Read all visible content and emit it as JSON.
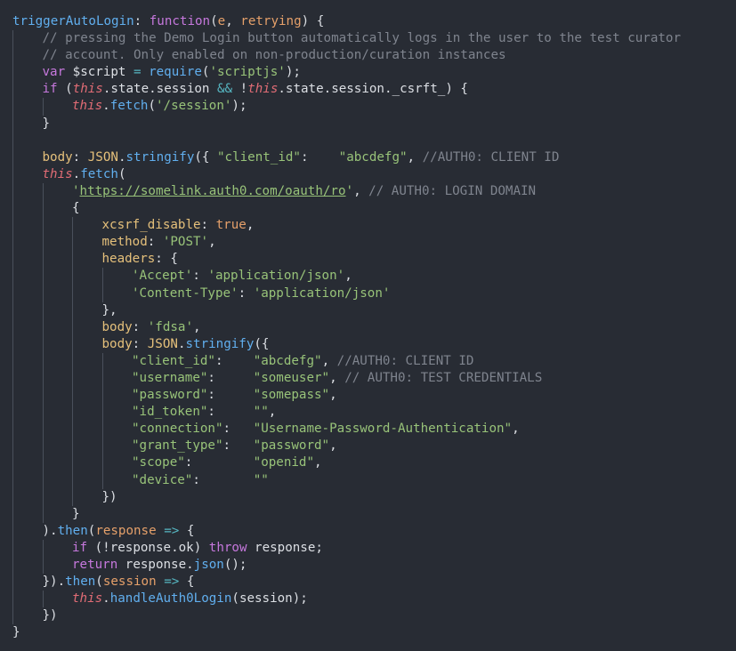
{
  "editor": {
    "background": "#282c34",
    "lines": [
      {
        "indent": 0,
        "tokens": [
          [
            "func",
            "triggerAutoLogin"
          ],
          [
            "punc",
            ": "
          ],
          [
            "kw",
            "function"
          ],
          [
            "punc",
            "("
          ],
          [
            "param",
            "e"
          ],
          [
            "punc",
            ", "
          ],
          [
            "param",
            "retrying"
          ],
          [
            "punc",
            ") {"
          ]
        ]
      },
      {
        "indent": 1,
        "tokens": [
          [
            "cmt",
            "// pressing the Demo Login button automatically logs in the user to the test curator"
          ]
        ]
      },
      {
        "indent": 1,
        "tokens": [
          [
            "cmt",
            "// account. Only enabled on non-production/curation instances"
          ]
        ]
      },
      {
        "indent": 1,
        "tokens": [
          [
            "kw",
            "var"
          ],
          [
            "plain",
            " $script "
          ],
          [
            "op",
            "="
          ],
          [
            "plain",
            " "
          ],
          [
            "func",
            "require"
          ],
          [
            "punc",
            "("
          ],
          [
            "str",
            "'scriptjs'"
          ],
          [
            "punc",
            ");"
          ]
        ]
      },
      {
        "indent": 1,
        "tokens": [
          [
            "kw",
            "if"
          ],
          [
            "punc",
            " ("
          ],
          [
            "this",
            "this"
          ],
          [
            "punc",
            "."
          ],
          [
            "plain",
            "state"
          ],
          [
            "punc",
            "."
          ],
          [
            "plain",
            "session "
          ],
          [
            "op",
            "&&"
          ],
          [
            "punc",
            " !"
          ],
          [
            "this",
            "this"
          ],
          [
            "punc",
            "."
          ],
          [
            "plain",
            "state"
          ],
          [
            "punc",
            "."
          ],
          [
            "plain",
            "session"
          ],
          [
            "punc",
            "."
          ],
          [
            "plain",
            "_csrft_"
          ],
          [
            "punc",
            ") {"
          ]
        ]
      },
      {
        "indent": 2,
        "tokens": [
          [
            "this",
            "this"
          ],
          [
            "punc",
            "."
          ],
          [
            "func",
            "fetch"
          ],
          [
            "punc",
            "("
          ],
          [
            "str",
            "'/session'"
          ],
          [
            "punc",
            ");"
          ]
        ]
      },
      {
        "indent": 1,
        "tokens": [
          [
            "punc",
            "}"
          ]
        ]
      },
      {
        "indent": 1,
        "tokens": []
      },
      {
        "indent": 1,
        "tokens": [
          [
            "prop",
            "body"
          ],
          [
            "punc",
            ": "
          ],
          [
            "obj",
            "JSON"
          ],
          [
            "punc",
            "."
          ],
          [
            "func",
            "stringify"
          ],
          [
            "punc",
            "({ "
          ],
          [
            "str",
            "\"client_id\""
          ],
          [
            "punc",
            ":    "
          ],
          [
            "str",
            "\"abcdefg\""
          ],
          [
            "punc",
            ", "
          ],
          [
            "cmt",
            "//AUTH0: CLIENT ID"
          ]
        ]
      },
      {
        "indent": 1,
        "tokens": [
          [
            "this",
            "this"
          ],
          [
            "punc",
            "."
          ],
          [
            "func",
            "fetch"
          ],
          [
            "punc",
            "("
          ]
        ]
      },
      {
        "indent": 2,
        "tokens": [
          [
            "str",
            "'"
          ],
          [
            "link",
            "https://somelink.auth0.com/oauth/ro"
          ],
          [
            "str",
            "'"
          ],
          [
            "punc",
            ", "
          ],
          [
            "cmt",
            "// AUTH0: LOGIN DOMAIN"
          ]
        ]
      },
      {
        "indent": 2,
        "tokens": [
          [
            "punc",
            "{"
          ]
        ]
      },
      {
        "indent": 3,
        "tokens": [
          [
            "prop",
            "xcsrf_disable"
          ],
          [
            "punc",
            ": "
          ],
          [
            "bool",
            "true"
          ],
          [
            "punc",
            ","
          ]
        ]
      },
      {
        "indent": 3,
        "tokens": [
          [
            "prop",
            "method"
          ],
          [
            "punc",
            ": "
          ],
          [
            "str",
            "'POST'"
          ],
          [
            "punc",
            ","
          ]
        ]
      },
      {
        "indent": 3,
        "tokens": [
          [
            "prop",
            "headers"
          ],
          [
            "punc",
            ": {"
          ]
        ]
      },
      {
        "indent": 4,
        "tokens": [
          [
            "str",
            "'Accept'"
          ],
          [
            "punc",
            ": "
          ],
          [
            "str",
            "'application/json'"
          ],
          [
            "punc",
            ","
          ]
        ]
      },
      {
        "indent": 4,
        "tokens": [
          [
            "str",
            "'Content-Type'"
          ],
          [
            "punc",
            ": "
          ],
          [
            "str",
            "'application/json'"
          ]
        ]
      },
      {
        "indent": 3,
        "tokens": [
          [
            "punc",
            "},"
          ]
        ]
      },
      {
        "indent": 3,
        "tokens": [
          [
            "prop",
            "body"
          ],
          [
            "punc",
            ": "
          ],
          [
            "str",
            "'fdsa'"
          ],
          [
            "punc",
            ","
          ]
        ]
      },
      {
        "indent": 3,
        "tokens": [
          [
            "prop",
            "body"
          ],
          [
            "punc",
            ": "
          ],
          [
            "obj",
            "JSON"
          ],
          [
            "punc",
            "."
          ],
          [
            "func",
            "stringify"
          ],
          [
            "punc",
            "({"
          ]
        ]
      },
      {
        "indent": 4,
        "tokens": [
          [
            "str",
            "\"client_id\""
          ],
          [
            "punc",
            ":    "
          ],
          [
            "str",
            "\"abcdefg\""
          ],
          [
            "punc",
            ", "
          ],
          [
            "cmt",
            "//AUTH0: CLIENT ID"
          ]
        ]
      },
      {
        "indent": 4,
        "tokens": [
          [
            "str",
            "\"username\""
          ],
          [
            "punc",
            ":     "
          ],
          [
            "str",
            "\"someuser\""
          ],
          [
            "punc",
            ", "
          ],
          [
            "cmt",
            "// AUTH0: TEST CREDENTIALS"
          ]
        ]
      },
      {
        "indent": 4,
        "tokens": [
          [
            "str",
            "\"password\""
          ],
          [
            "punc",
            ":     "
          ],
          [
            "str",
            "\"somepass\""
          ],
          [
            "punc",
            ","
          ]
        ]
      },
      {
        "indent": 4,
        "tokens": [
          [
            "str",
            "\"id_token\""
          ],
          [
            "punc",
            ":     "
          ],
          [
            "str",
            "\"\""
          ],
          [
            "punc",
            ","
          ]
        ]
      },
      {
        "indent": 4,
        "tokens": [
          [
            "str",
            "\"connection\""
          ],
          [
            "punc",
            ":   "
          ],
          [
            "str",
            "\"Username-Password-Authentication\""
          ],
          [
            "punc",
            ","
          ]
        ]
      },
      {
        "indent": 4,
        "tokens": [
          [
            "str",
            "\"grant_type\""
          ],
          [
            "punc",
            ":   "
          ],
          [
            "str",
            "\"password\""
          ],
          [
            "punc",
            ","
          ]
        ]
      },
      {
        "indent": 4,
        "tokens": [
          [
            "str",
            "\"scope\""
          ],
          [
            "punc",
            ":        "
          ],
          [
            "str",
            "\"openid\""
          ],
          [
            "punc",
            ","
          ]
        ]
      },
      {
        "indent": 4,
        "tokens": [
          [
            "str",
            "\"device\""
          ],
          [
            "punc",
            ":       "
          ],
          [
            "str",
            "\"\""
          ]
        ]
      },
      {
        "indent": 3,
        "tokens": [
          [
            "punc",
            "})"
          ]
        ]
      },
      {
        "indent": 2,
        "tokens": [
          [
            "punc",
            "}"
          ]
        ]
      },
      {
        "indent": 1,
        "tokens": [
          [
            "punc",
            ")."
          ],
          [
            "func",
            "then"
          ],
          [
            "punc",
            "("
          ],
          [
            "param",
            "response"
          ],
          [
            "punc",
            " "
          ],
          [
            "op",
            "=>"
          ],
          [
            "punc",
            " {"
          ]
        ]
      },
      {
        "indent": 2,
        "tokens": [
          [
            "kw",
            "if"
          ],
          [
            "punc",
            " (!"
          ],
          [
            "plain",
            "response"
          ],
          [
            "punc",
            "."
          ],
          [
            "plain",
            "ok"
          ],
          [
            "punc",
            ") "
          ],
          [
            "kw",
            "throw"
          ],
          [
            "plain",
            " response"
          ],
          [
            "punc",
            ";"
          ]
        ]
      },
      {
        "indent": 2,
        "tokens": [
          [
            "kw",
            "return"
          ],
          [
            "plain",
            " response"
          ],
          [
            "punc",
            "."
          ],
          [
            "func",
            "json"
          ],
          [
            "punc",
            "();"
          ]
        ]
      },
      {
        "indent": 1,
        "tokens": [
          [
            "punc",
            "})."
          ],
          [
            "func",
            "then"
          ],
          [
            "punc",
            "("
          ],
          [
            "param",
            "session"
          ],
          [
            "punc",
            " "
          ],
          [
            "op",
            "=>"
          ],
          [
            "punc",
            " {"
          ]
        ]
      },
      {
        "indent": 2,
        "tokens": [
          [
            "this",
            "this"
          ],
          [
            "punc",
            "."
          ],
          [
            "func",
            "handleAuth0Login"
          ],
          [
            "punc",
            "("
          ],
          [
            "plain",
            "session"
          ],
          [
            "punc",
            ");"
          ]
        ]
      },
      {
        "indent": 1,
        "tokens": [
          [
            "punc",
            "})"
          ]
        ]
      },
      {
        "indent": 0,
        "tokens": [
          [
            "punc",
            "}"
          ]
        ]
      }
    ]
  }
}
